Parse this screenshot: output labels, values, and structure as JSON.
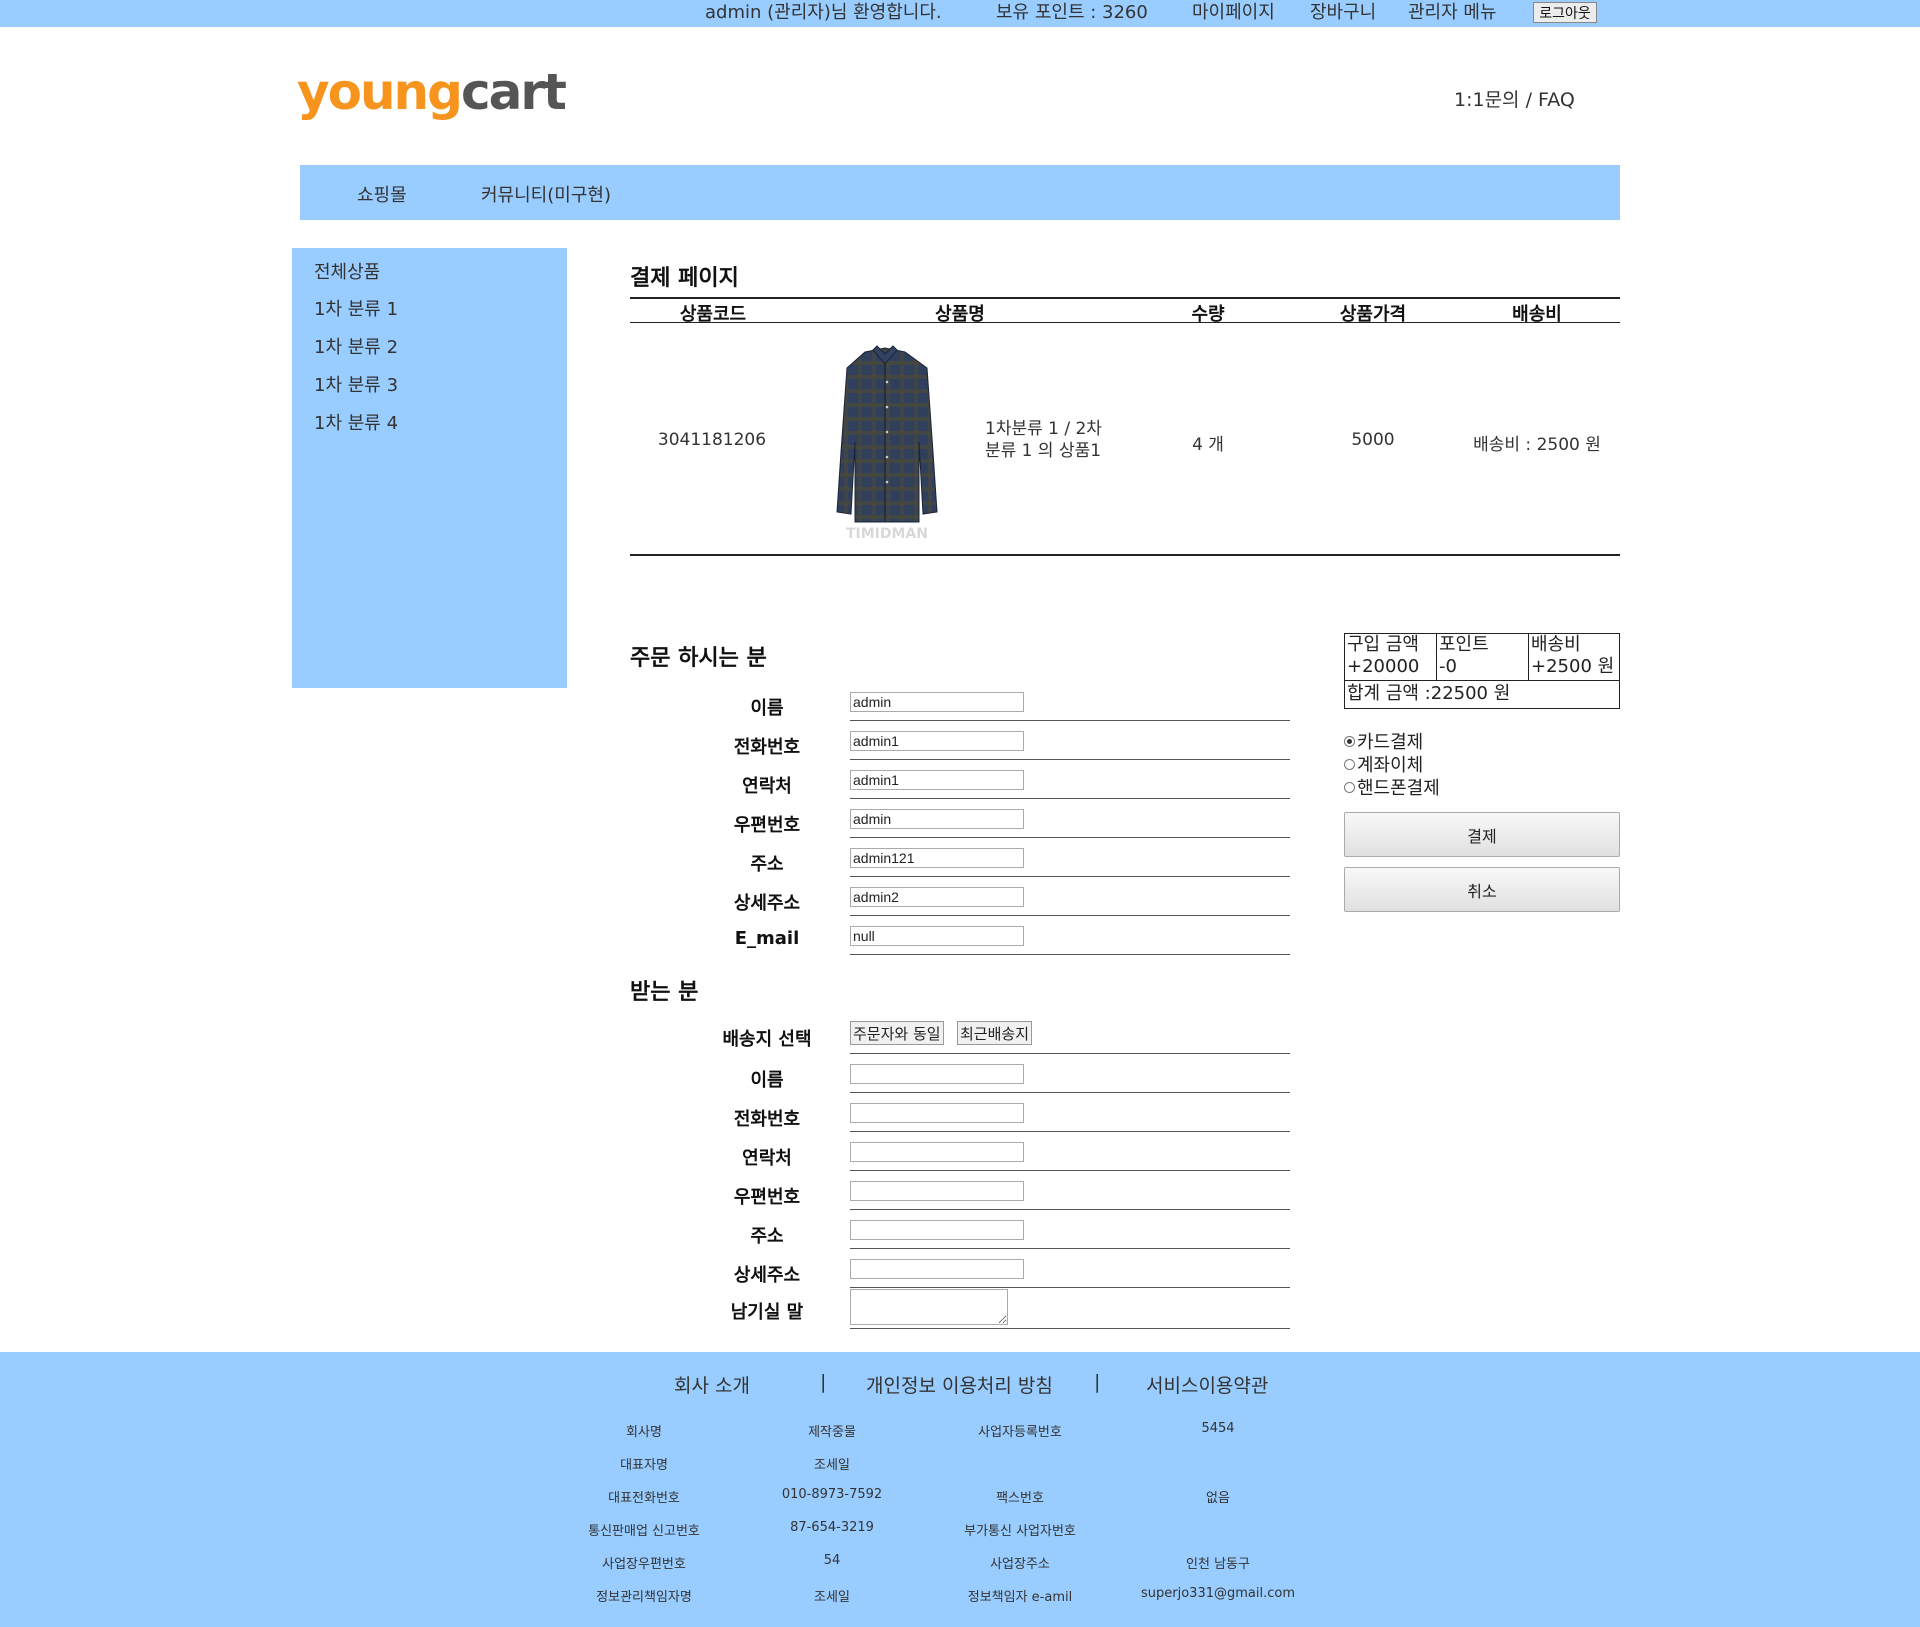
{
  "topbar": {
    "welcome": "admin (관리자)님 환영합니다.",
    "points": "보유 포인트 : 3260",
    "mypage": "마이페이지",
    "cart": "장바구니",
    "admin_menu": "관리자 메뉴",
    "logout": "로그아웃"
  },
  "header": {
    "logo_part1": "young",
    "logo_part2": "cart",
    "faq": "1:1문의 / FAQ"
  },
  "nav": {
    "items": [
      "쇼핑몰",
      "커뮤니티(미구현)"
    ]
  },
  "sidebar": {
    "items": [
      "전체상품",
      "1차 분류 1",
      "1차 분류 2",
      "1차 분류 3",
      "1차 분류 4"
    ]
  },
  "page": {
    "title": "결제 페이지"
  },
  "product_table": {
    "headers": [
      "상품코드",
      "상품명",
      "수량",
      "상품가격",
      "배송비"
    ],
    "row": {
      "code": "3041181206",
      "image_watermark": "TIMIDMAN",
      "name_line1": "1차분류 1 / 2차",
      "name_line2": "분류 1 의 상품1",
      "qty": "4 개",
      "price": "5000",
      "shipping": "배송비 : 2500 원"
    }
  },
  "orderer": {
    "title": "주문 하시는 분",
    "fields": [
      {
        "label": "이름",
        "value": "admin"
      },
      {
        "label": "전화번호",
        "value": "admin1"
      },
      {
        "label": "연락처",
        "value": "admin1"
      },
      {
        "label": "우편번호",
        "value": "admin"
      },
      {
        "label": "주소",
        "value": "admin121"
      },
      {
        "label": "상세주소",
        "value": "admin2"
      },
      {
        "label": "E_mail",
        "value": "null"
      }
    ]
  },
  "receiver": {
    "title": "받는 분",
    "select_label": "배송지 선택",
    "same_button": "주문자와 동일",
    "recent_button": "최근배송지",
    "fields": [
      {
        "label": "이름",
        "value": ""
      },
      {
        "label": "전화번호",
        "value": ""
      },
      {
        "label": "연락처",
        "value": ""
      },
      {
        "label": "우편번호",
        "value": ""
      },
      {
        "label": "주소",
        "value": ""
      },
      {
        "label": "상세주소",
        "value": ""
      }
    ],
    "memo_label": "남기실 말"
  },
  "summary": {
    "purchase_label": "구입 금액",
    "purchase_value": "+20000",
    "point_label": "포인트",
    "point_value": "-0",
    "shipping_label": "배송비",
    "shipping_value": "+2500 원",
    "total": "합계 금액 :22500 원"
  },
  "payment": {
    "options": [
      "카드결제",
      "계좌이체",
      "핸드폰결제"
    ],
    "selected": "카드결제",
    "pay_button": "결제",
    "cancel_button": "취소"
  },
  "footer": {
    "links": [
      "회사 소개",
      "|",
      "개인정보 이용처리 방침",
      "|",
      "서비스이용약관"
    ],
    "rows": [
      [
        "회사명",
        "제작중물",
        "사업자등록번호",
        "5454"
      ],
      [
        "대표자명",
        "조세일",
        "",
        ""
      ],
      [
        "대표전화번호",
        "010-8973-7592",
        "팩스번호",
        "없음"
      ],
      [
        "통신판매업 신고번호",
        "87-654-3219",
        "부가통신 사업자번호",
        ""
      ],
      [
        "사업장우편번호",
        "54",
        "사업장주소",
        "인천 남동구"
      ],
      [
        "정보관리책임자명",
        "조세일",
        "정보책임자 e-amil",
        "superjo331@gmail.com"
      ]
    ]
  },
  "colors": {
    "accent": "#99ccff",
    "logo_orange": "#f7941d",
    "logo_gray": "#555555"
  }
}
